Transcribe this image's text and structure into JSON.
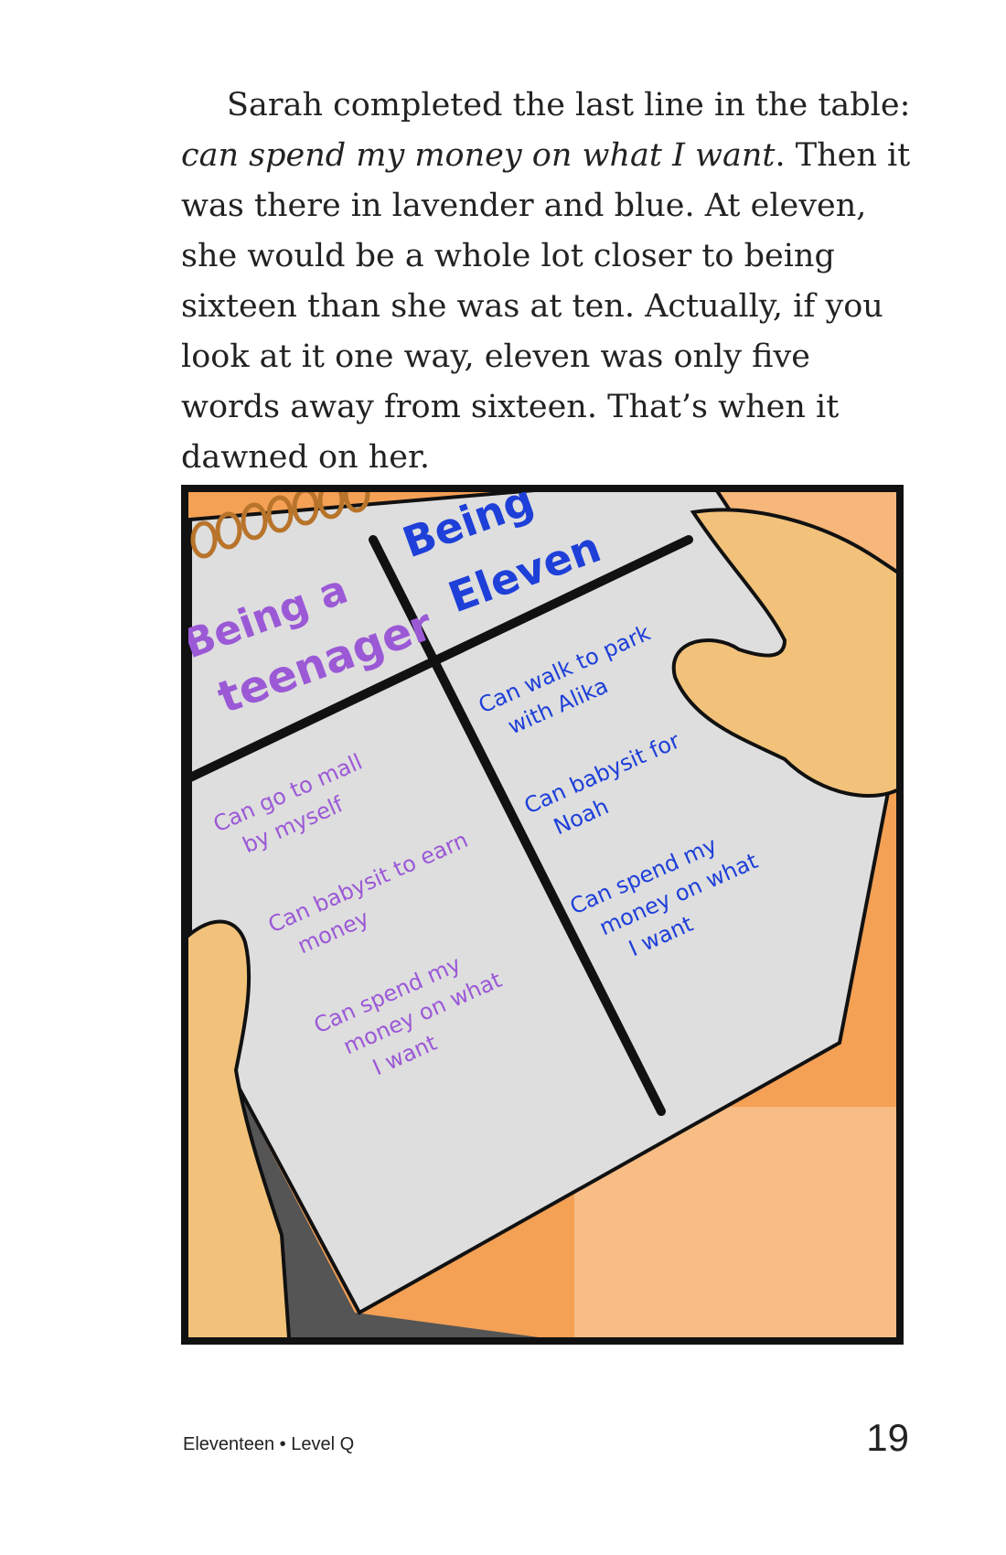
{
  "story": {
    "line1": "Sarah completed the last line in the table:",
    "italic_phrase": "can spend my money on what I want",
    "after_italic": ". Then it was there in lavender and blue. At eleven, she would be a whole lot closer to being sixteen than she was at ten. Actually, if you look at it one way, eleven was only five words away from sixteen. That’s when it dawned on her."
  },
  "notebook": {
    "left_header_line1": "Being a",
    "left_header_line2": "teenager",
    "right_header_line1": "Being",
    "right_header_line2": "Eleven",
    "left_items": [
      [
        "Can go to mall",
        "by myself"
      ],
      [
        "Can babysit to earn",
        "money"
      ],
      [
        "Can spend my",
        "money on what",
        "I want"
      ]
    ],
    "right_items": [
      [
        "Can walk to park",
        "with Alika"
      ],
      [
        "Can babysit for",
        "Noah"
      ],
      [
        "Can spend my",
        "money on what",
        "I want"
      ]
    ],
    "colors": {
      "lavender": "#9b59d6",
      "blue": "#1e3fd8",
      "background_orange": "#f4a055",
      "paper": "#dcdcdc",
      "skin": "#f2c27a"
    }
  },
  "footer": {
    "title": "Eleventeen • Level Q",
    "page_number": "19"
  }
}
